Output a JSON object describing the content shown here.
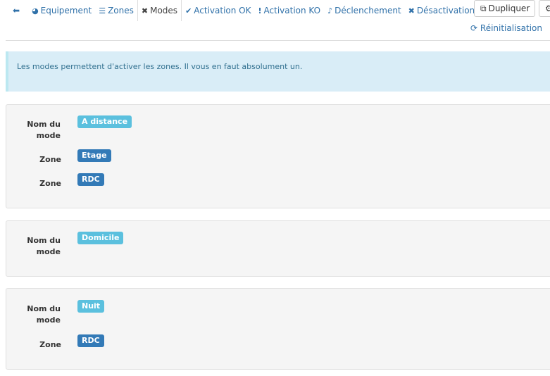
{
  "nav": {
    "items": [
      {
        "icon": "arrow-left-circle-icon",
        "glyph": "➜",
        "label": ""
      },
      {
        "icon": "dashboard-icon",
        "glyph": "◕",
        "label": "Equipement"
      },
      {
        "icon": "list-icon",
        "glyph": "☰",
        "label": "Zones"
      },
      {
        "icon": "modes-icon",
        "glyph": "✖",
        "label": "Modes",
        "active": true
      },
      {
        "icon": "check-icon",
        "glyph": "✔",
        "label": "Activation OK"
      },
      {
        "icon": "exclamation-icon",
        "glyph": "!",
        "label": "Activation KO"
      },
      {
        "icon": "bell-icon",
        "glyph": "🔔",
        "label": "Déclenchement"
      },
      {
        "icon": "times-icon",
        "glyph": "✖",
        "label": "Désactivation OK"
      }
    ]
  },
  "toolbar": {
    "duplicate_label": "Dupliquer",
    "reinit_label": "Réinitialisation"
  },
  "alert": {
    "text": "Les modes permettent d'activer les zones. Il vous en faut absolument un."
  },
  "labels": {
    "mode": "Nom du mode",
    "zone": "Zone"
  },
  "modes": [
    {
      "name": "A distance",
      "zones": [
        "Etage",
        "RDC"
      ]
    },
    {
      "name": "Domicile",
      "zones": []
    },
    {
      "name": "Nuit",
      "zones": [
        "RDC"
      ]
    }
  ],
  "colors": {
    "link": "#3071a9",
    "mode_badge": "#5bc0de",
    "zone_badge": "#337ab7",
    "alert_bg": "#d9edf7"
  }
}
